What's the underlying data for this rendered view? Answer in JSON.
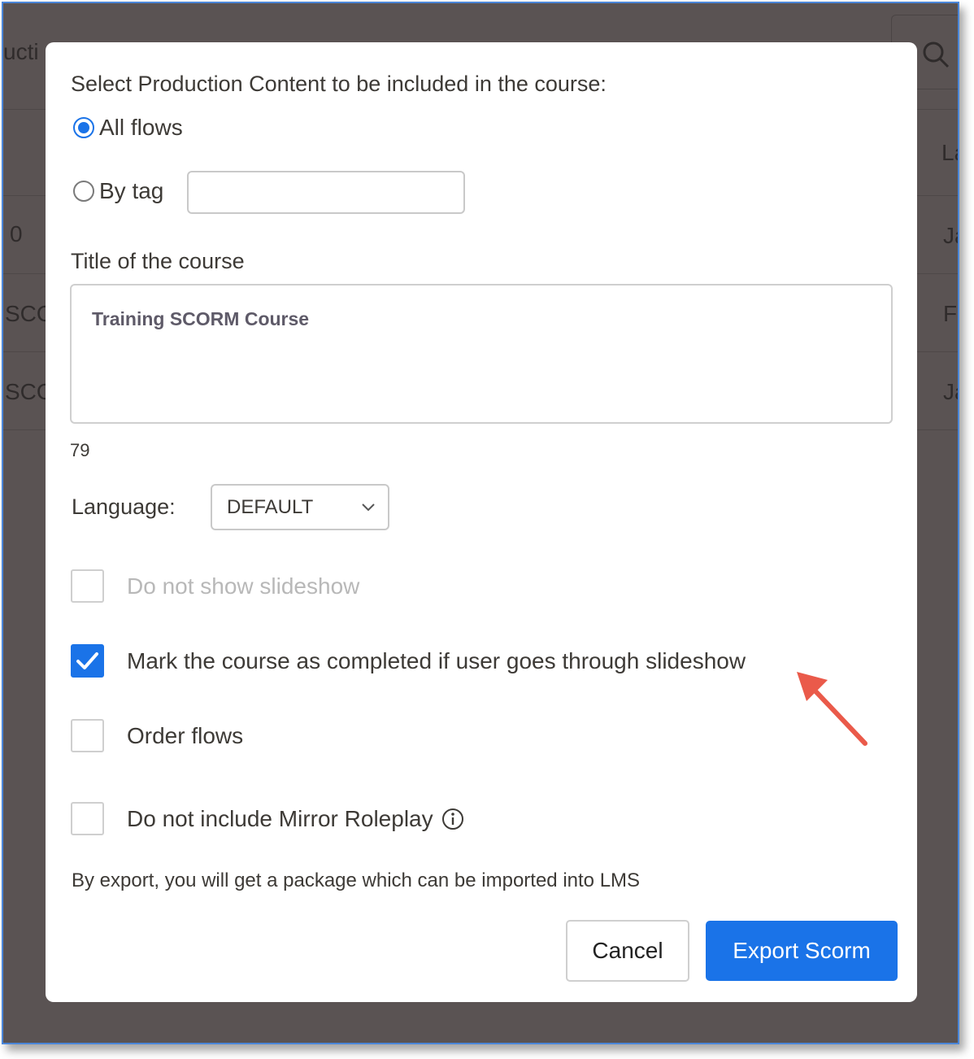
{
  "background": {
    "fragments": [
      "ucti",
      "0",
      "SCO",
      "SCO",
      "La",
      "Ja",
      "Fe",
      "Ja"
    ]
  },
  "dialog": {
    "heading": "Select Production Content to be included in the course:",
    "radio_all_flows": "All flows",
    "radio_by_tag": "By tag",
    "tag_input_value": "",
    "title_label": "Title of the course",
    "title_value": "Training SCORM Course",
    "char_count": "79",
    "language_label": "Language:",
    "language_selected": "DEFAULT",
    "options": [
      {
        "label": "Do not show slideshow",
        "checked": false,
        "disabled": true
      },
      {
        "label": "Mark the course as completed if user goes through slideshow",
        "checked": true,
        "disabled": false
      },
      {
        "label": "Order flows",
        "checked": false,
        "disabled": false
      },
      {
        "label": "Do not include Mirror Roleplay",
        "checked": false,
        "disabled": false
      }
    ],
    "note": "By export, you will get a package which can be imported into LMS",
    "cancel_label": "Cancel",
    "export_label": "Export Scorm"
  },
  "colors": {
    "accent": "#1a73e8",
    "overlay": "#5a5353",
    "annotation_arrow": "#ea5a4a"
  },
  "icons": [
    "search-icon",
    "info-icon",
    "chevron-down-icon",
    "checkmark-icon",
    "annotation-arrow-icon"
  ]
}
